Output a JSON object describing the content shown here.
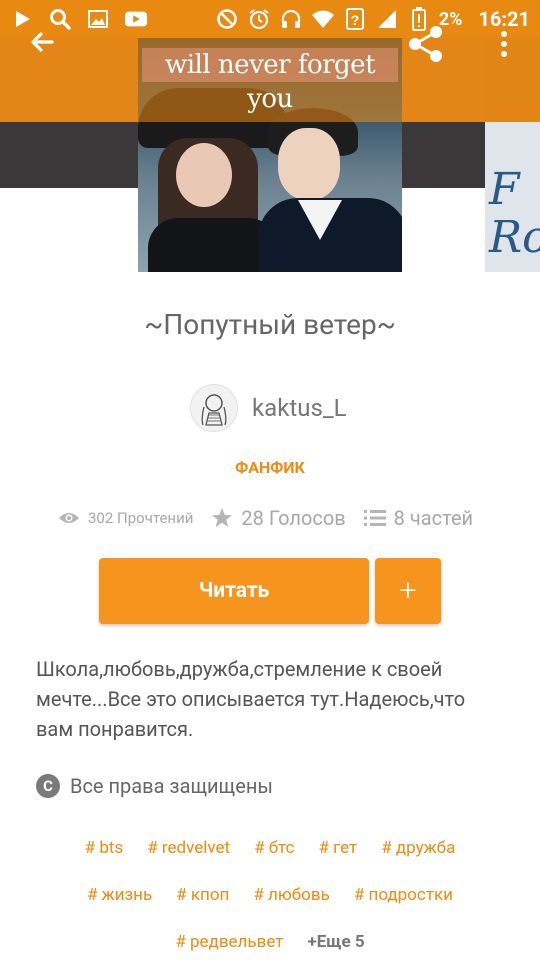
{
  "status_bar": {
    "icons_left": [
      "play-icon",
      "search-icon",
      "image-icon",
      "youtube-icon"
    ],
    "icons_right": [
      "block-icon",
      "alarm-icon",
      "headset-icon",
      "wifi-icon",
      "signal-question-icon",
      "signal-icon",
      "battery-alert-icon"
    ],
    "battery": "2%",
    "time": "16:21"
  },
  "toolbar": {
    "back_icon": "arrow-back-icon",
    "share_icon": "share-icon",
    "more_icon": "more-vert-icon"
  },
  "cover": {
    "title_text": "will never forget you"
  },
  "peek_card": {
    "text": "F\nRo"
  },
  "story": {
    "title": "~Попутный ветер~",
    "author": "kaktus_L",
    "genre": "ФАНФИК",
    "reads": "302 Прочтений",
    "votes": "28 Голосов",
    "parts": "8 частей",
    "read_button": "Читать",
    "add_button": "+",
    "description": "Школа,любовь,дружба,стремление к своей мечте...Все это описывается тут.Надеюсь,что вам понравится.",
    "copyright": "Все права защищены"
  },
  "tags": {
    "row1": [
      "# bts",
      "# redvelvet",
      "# бтс",
      "# гет",
      "# дружба"
    ],
    "row2": [
      "# жизнь",
      "# кпоп",
      "# любовь",
      "# подростки"
    ],
    "row3": [
      "# редвельвет"
    ],
    "more": "+Еще 5"
  },
  "colors": {
    "accent": "#f7941d",
    "status_bar": "#e88a12",
    "text": "#555555",
    "muted": "#a8a8a8"
  }
}
